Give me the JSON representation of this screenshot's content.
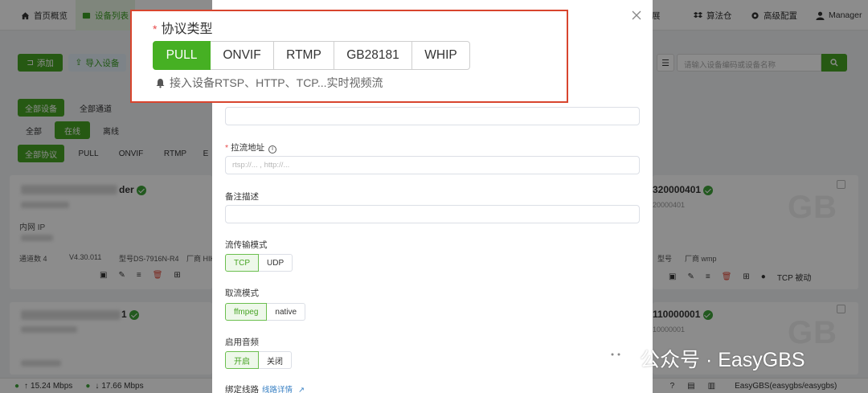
{
  "nav": {
    "home": "首页概览",
    "devices": "设备列表",
    "service_ext": "务扩展",
    "algo": "算法仓",
    "advanced": "高级配置",
    "user": "Manager"
  },
  "toolbar": {
    "add": "添加",
    "import": "导入设备",
    "search_placeholder": "请输入设备编码或设备名称"
  },
  "filters": {
    "scope": [
      "全部设备",
      "全部通道"
    ],
    "status": [
      "全部",
      "在线",
      "离线"
    ],
    "protocol": [
      "全部协议",
      "PULL",
      "ONVIF",
      "RTMP",
      "E"
    ]
  },
  "cards": {
    "card1": {
      "name_suffix": "der",
      "lan_label": "内网 IP",
      "channels": "通道数 4",
      "version": "V4.30.011",
      "model": "型号DS-7916N-R4",
      "vendor": "厂商 HIK"
    },
    "card2": {
      "name_suffix": "1"
    },
    "card3": {
      "id": "320000401",
      "sub": "20000401",
      "model": "型号",
      "vendor": "厂商 wmp",
      "tcp_mode": "TCP 被动",
      "watermark": "GB"
    },
    "card4": {
      "id": "110000001",
      "sub": "10000001",
      "watermark": "GB"
    }
  },
  "status_bar": {
    "up": "15.24 Mbps",
    "down": "17.66 Mbps",
    "right": "EasyGBS(easygbs/easygbs)"
  },
  "dialog": {
    "protocol_title": "协议类型",
    "protocols": [
      "PULL",
      "ONVIF",
      "RTMP",
      "GB28181",
      "WHIP"
    ],
    "selected_protocol": "PULL",
    "protocol_hint": "接入设备RTSP、HTTP、TCP...实时视频流",
    "pull_url_label": "拉流地址",
    "pull_url_placeholder": "rtsp://... , http://...",
    "remark_label": "备注描述",
    "transport_label": "流传输模式",
    "transport_options": [
      "TCP",
      "UDP"
    ],
    "fetch_label": "取流模式",
    "fetch_options": [
      "ffmpeg",
      "native"
    ],
    "audio_label": "启用音频",
    "audio_options": [
      "开启",
      "关闭"
    ],
    "route_label": "绑定线路",
    "route_link": "线路详情"
  },
  "watermark": "公众号 · EasyGBS",
  "colors": {
    "accent": "#46a323",
    "highlight_border": "#d8452e",
    "required": "#e84a4a"
  }
}
